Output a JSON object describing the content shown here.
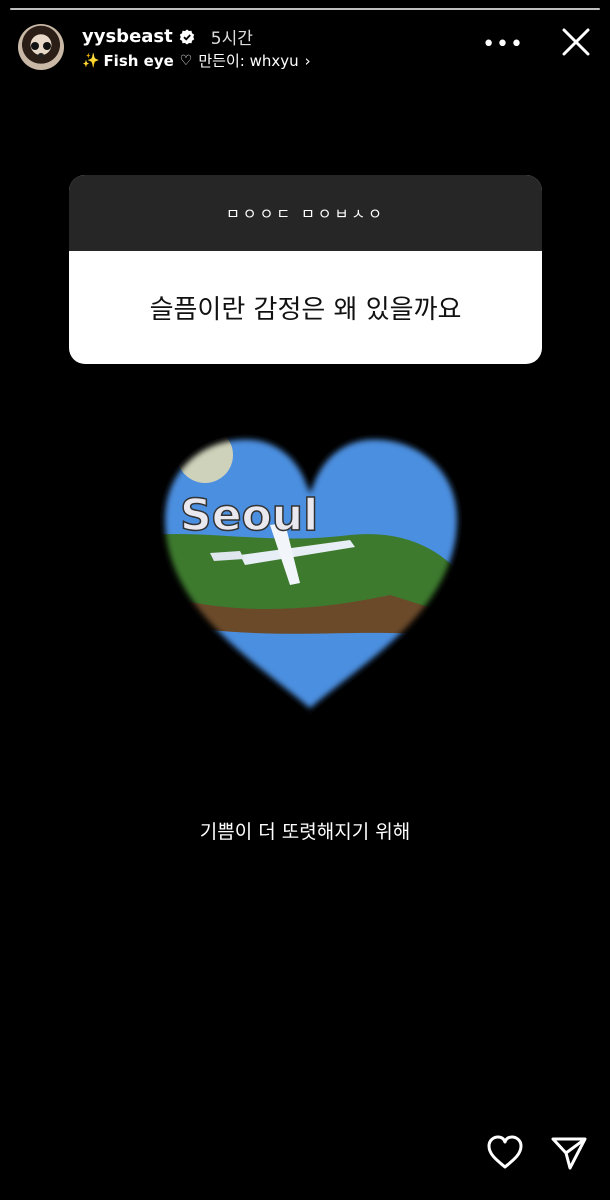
{
  "header": {
    "username": "yysbeast",
    "time_ago": "5시간",
    "effect_name": "Fish eye",
    "creator_label": "만든이: whxyu",
    "more_label": "•••"
  },
  "question_sticker": {
    "prompt": "ㅁㅇㅇㄷ ㅁㅇㅂㅅㅇ",
    "question": "슬픔이란 감정은 왜 있을까요"
  },
  "photo": {
    "map_label": "Seoul"
  },
  "caption": "기쁨이 더 또렷해지기 위해",
  "colors": {
    "background": "#000000",
    "sticker_top": "#262626",
    "sticker_bottom": "#ffffff"
  },
  "icons": [
    "verified-icon",
    "sparkle-icon",
    "heart-small-icon",
    "chevron-right-icon",
    "more-icon",
    "close-icon",
    "like-icon",
    "share-icon"
  ]
}
